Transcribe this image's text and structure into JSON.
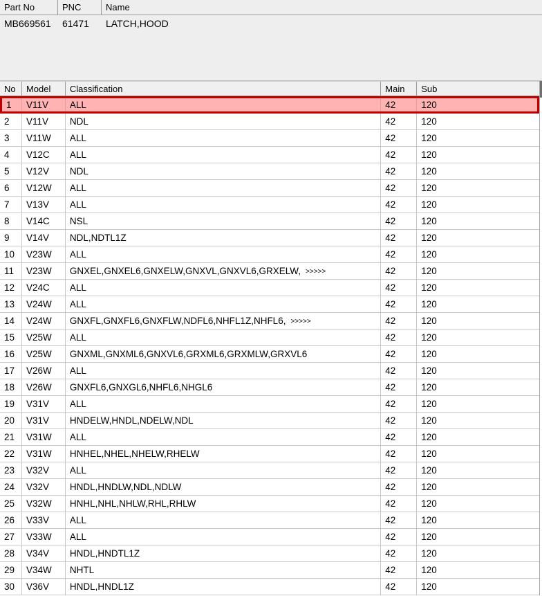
{
  "top_panel": {
    "columns": [
      "Part No",
      "PNC",
      "Name"
    ],
    "row": {
      "part_no": "MB669561",
      "pnc": "61471",
      "name": "LATCH,HOOD"
    }
  },
  "grid": {
    "columns": [
      "No",
      "Model",
      "Classification",
      "Main",
      "Sub"
    ],
    "selected_row_index": 0,
    "colors": {
      "selection_fill": "#ffb3b3",
      "selection_border": "#c00000",
      "header_bg": "#f0f0f0",
      "panel_bg": "#eeeeee",
      "grid_line": "#c8c8c8"
    },
    "more_marker": ">>>>>",
    "rows": [
      {
        "no": "1",
        "model": "V11V",
        "classification": "ALL",
        "more": "",
        "main": "42",
        "sub": "120"
      },
      {
        "no": "2",
        "model": "V11V",
        "classification": "NDL",
        "more": "",
        "main": "42",
        "sub": "120"
      },
      {
        "no": "3",
        "model": "V11W",
        "classification": "ALL",
        "more": "",
        "main": "42",
        "sub": "120"
      },
      {
        "no": "4",
        "model": "V12C",
        "classification": "ALL",
        "more": "",
        "main": "42",
        "sub": "120"
      },
      {
        "no": "5",
        "model": "V12V",
        "classification": "NDL",
        "more": "",
        "main": "42",
        "sub": "120"
      },
      {
        "no": "6",
        "model": "V12W",
        "classification": "ALL",
        "more": "",
        "main": "42",
        "sub": "120"
      },
      {
        "no": "7",
        "model": "V13V",
        "classification": "ALL",
        "more": "",
        "main": "42",
        "sub": "120"
      },
      {
        "no": "8",
        "model": "V14C",
        "classification": "NSL",
        "more": "",
        "main": "42",
        "sub": "120"
      },
      {
        "no": "9",
        "model": "V14V",
        "classification": "NDL,NDTL1Z",
        "more": "",
        "main": "42",
        "sub": "120"
      },
      {
        "no": "10",
        "model": "V23W",
        "classification": "ALL",
        "more": "",
        "main": "42",
        "sub": "120"
      },
      {
        "no": "11",
        "model": "V23W",
        "classification": "GNXEL,GNXEL6,GNXELW,GNXVL,GNXVL6,GRXELW,",
        "more": ">>>>>",
        "main": "42",
        "sub": "120"
      },
      {
        "no": "12",
        "model": "V24C",
        "classification": "ALL",
        "more": "",
        "main": "42",
        "sub": "120"
      },
      {
        "no": "13",
        "model": "V24W",
        "classification": "ALL",
        "more": "",
        "main": "42",
        "sub": "120"
      },
      {
        "no": "14",
        "model": "V24W",
        "classification": "GNXFL,GNXFL6,GNXFLW,NDFL6,NHFL1Z,NHFL6,",
        "more": ">>>>>",
        "main": "42",
        "sub": "120"
      },
      {
        "no": "15",
        "model": "V25W",
        "classification": "ALL",
        "more": "",
        "main": "42",
        "sub": "120"
      },
      {
        "no": "16",
        "model": "V25W",
        "classification": "GNXML,GNXML6,GNXVL6,GRXML6,GRXMLW,GRXVL6",
        "more": "",
        "main": "42",
        "sub": "120"
      },
      {
        "no": "17",
        "model": "V26W",
        "classification": "ALL",
        "more": "",
        "main": "42",
        "sub": "120"
      },
      {
        "no": "18",
        "model": "V26W",
        "classification": "GNXFL6,GNXGL6,NHFL6,NHGL6",
        "more": "",
        "main": "42",
        "sub": "120"
      },
      {
        "no": "19",
        "model": "V31V",
        "classification": "ALL",
        "more": "",
        "main": "42",
        "sub": "120"
      },
      {
        "no": "20",
        "model": "V31V",
        "classification": "HNDELW,HNDL,NDELW,NDL",
        "more": "",
        "main": "42",
        "sub": "120"
      },
      {
        "no": "21",
        "model": "V31W",
        "classification": "ALL",
        "more": "",
        "main": "42",
        "sub": "120"
      },
      {
        "no": "22",
        "model": "V31W",
        "classification": "HNHEL,NHEL,NHELW,RHELW",
        "more": "",
        "main": "42",
        "sub": "120"
      },
      {
        "no": "23",
        "model": "V32V",
        "classification": "ALL",
        "more": "",
        "main": "42",
        "sub": "120"
      },
      {
        "no": "24",
        "model": "V32V",
        "classification": "HNDL,HNDLW,NDL,NDLW",
        "more": "",
        "main": "42",
        "sub": "120"
      },
      {
        "no": "25",
        "model": "V32W",
        "classification": "HNHL,NHL,NHLW,RHL,RHLW",
        "more": "",
        "main": "42",
        "sub": "120"
      },
      {
        "no": "26",
        "model": "V33V",
        "classification": "ALL",
        "more": "",
        "main": "42",
        "sub": "120"
      },
      {
        "no": "27",
        "model": "V33W",
        "classification": "ALL",
        "more": "",
        "main": "42",
        "sub": "120"
      },
      {
        "no": "28",
        "model": "V34V",
        "classification": "HNDL,HNDTL1Z",
        "more": "",
        "main": "42",
        "sub": "120"
      },
      {
        "no": "29",
        "model": "V34W",
        "classification": "NHTL",
        "more": "",
        "main": "42",
        "sub": "120"
      },
      {
        "no": "30",
        "model": "V36V",
        "classification": "HNDL,HNDL1Z",
        "more": "",
        "main": "42",
        "sub": "120"
      }
    ]
  }
}
